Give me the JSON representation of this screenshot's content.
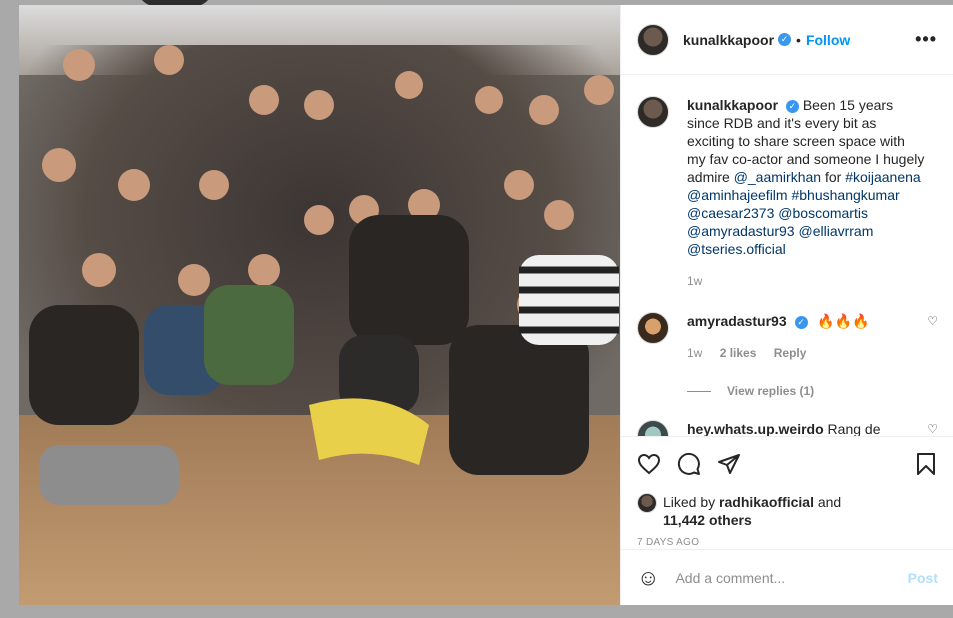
{
  "post": {
    "author": "kunalkkapoor",
    "follow_label": "Follow",
    "separator": "•",
    "more_label": "•••"
  },
  "caption": {
    "username": "kunalkkapoor",
    "text_start": "Been 15 years since RDB and it's every bit as exciting to share screen space with my fav co-actor and someone I hugely admire ",
    "mention1": "@_aamirkhan",
    "text_for": " for ",
    "hashtag": "#koijaanena",
    "mentions": [
      "@aminhajeefilm",
      "#bhushangkumar",
      "@caesar2373",
      "@boscomartis",
      "@amyradastur93",
      "@elliavrram",
      "@tseries.official"
    ],
    "age": "1w"
  },
  "comments": [
    {
      "username": "amyradastur93",
      "text": "🔥🔥🔥",
      "age": "1w",
      "likes": "2 likes",
      "reply_label": "Reply",
      "view_replies": "View replies (1)"
    },
    {
      "username": "hey.whats.up.weirdo",
      "text": "Rang de"
    }
  ],
  "likes": {
    "prefix": "Liked by ",
    "user": "radhikaofficial",
    "and": " and",
    "others": "11,442 others"
  },
  "timestamp": "7 DAYS AGO",
  "add_comment": {
    "placeholder": "Add a comment...",
    "post_label": "Post",
    "smile": "☺"
  },
  "icons": {
    "verified": "✓",
    "heart_small": "♡"
  },
  "colors": {
    "accent": "#0095f6",
    "link": "#00376b",
    "muted": "#8e8e8e",
    "post_disabled": "#b2dffc"
  }
}
